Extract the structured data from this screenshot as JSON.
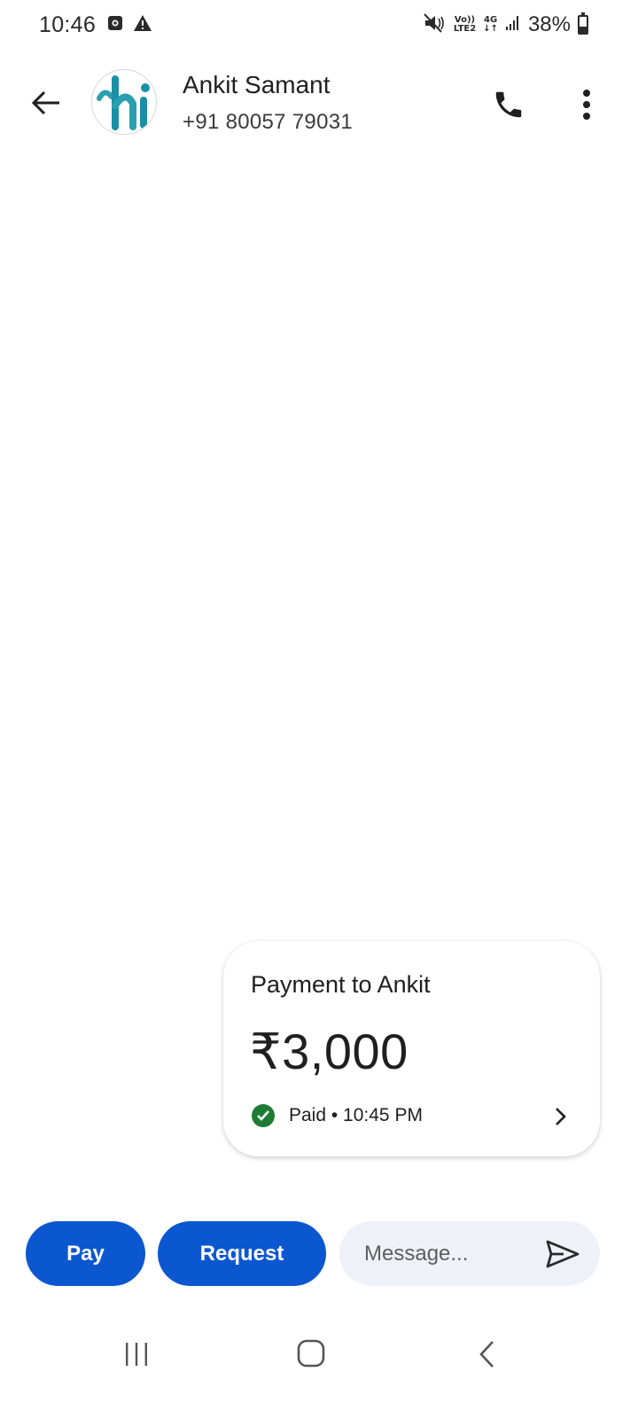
{
  "status_bar": {
    "time": "10:46",
    "network": {
      "volte": "Vo))",
      "lte": "LTE2",
      "gen": "4G",
      "arrows": "↓↑"
    },
    "battery_percent": "38%",
    "battery_level": 0.38,
    "icons": [
      "screenshot-icon",
      "warning-icon",
      "mute-icon",
      "signal-icon",
      "battery-icon"
    ]
  },
  "header": {
    "contact_name": "Ankit Samant",
    "contact_phone": "+91 80057 79031",
    "avatar_logo": "hi"
  },
  "payment_card": {
    "title": "Payment to Ankit",
    "amount": "₹3,000",
    "status": "Paid • 10:45 PM",
    "status_color": "#1e7b34"
  },
  "actions": {
    "pay_label": "Pay",
    "request_label": "Request",
    "message_placeholder": "Message...",
    "accent": "#0b57d0"
  }
}
